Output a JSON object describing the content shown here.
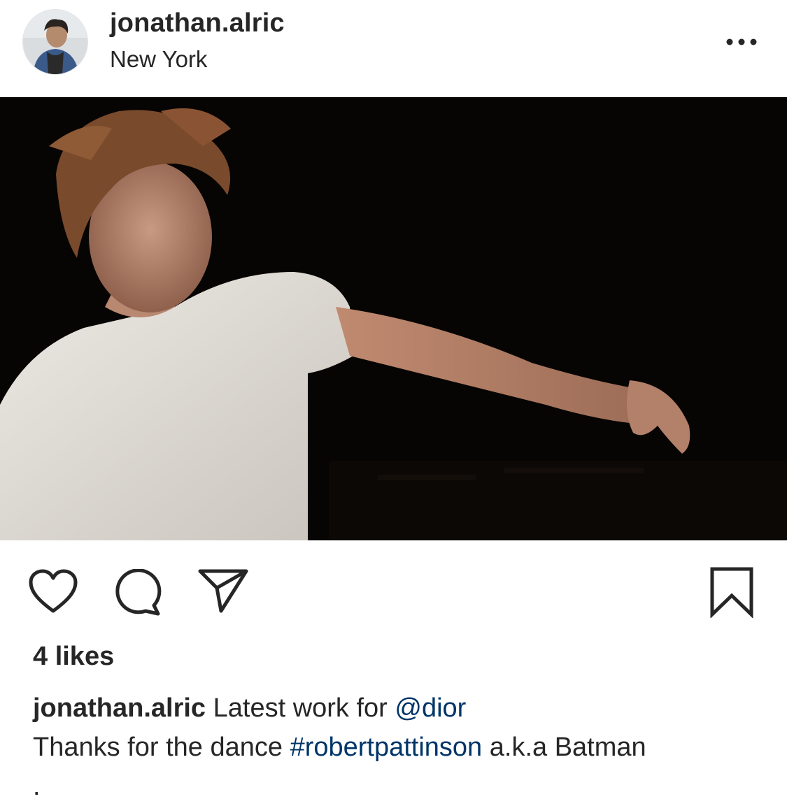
{
  "post": {
    "header": {
      "username": "jonathan.alric",
      "location": "New York"
    },
    "actions": {
      "like_icon": "heart-outline-icon",
      "comment_icon": "comment-bubble-icon",
      "share_icon": "paper-plane-icon",
      "save_icon": "bookmark-icon",
      "more_icon": "ellipsis-icon"
    },
    "likes_text": "4 likes",
    "caption": {
      "username": "jonathan.alric",
      "text_1": " Latest work for ",
      "mention": "@dior",
      "text_2": "Thanks for the dance ",
      "hashtag": "#robertpattinson",
      "text_3": " a.k.a Batman",
      "trailing": "."
    }
  },
  "colors": {
    "text": "#262626",
    "link": "#003569",
    "media_bg": "#000000"
  }
}
